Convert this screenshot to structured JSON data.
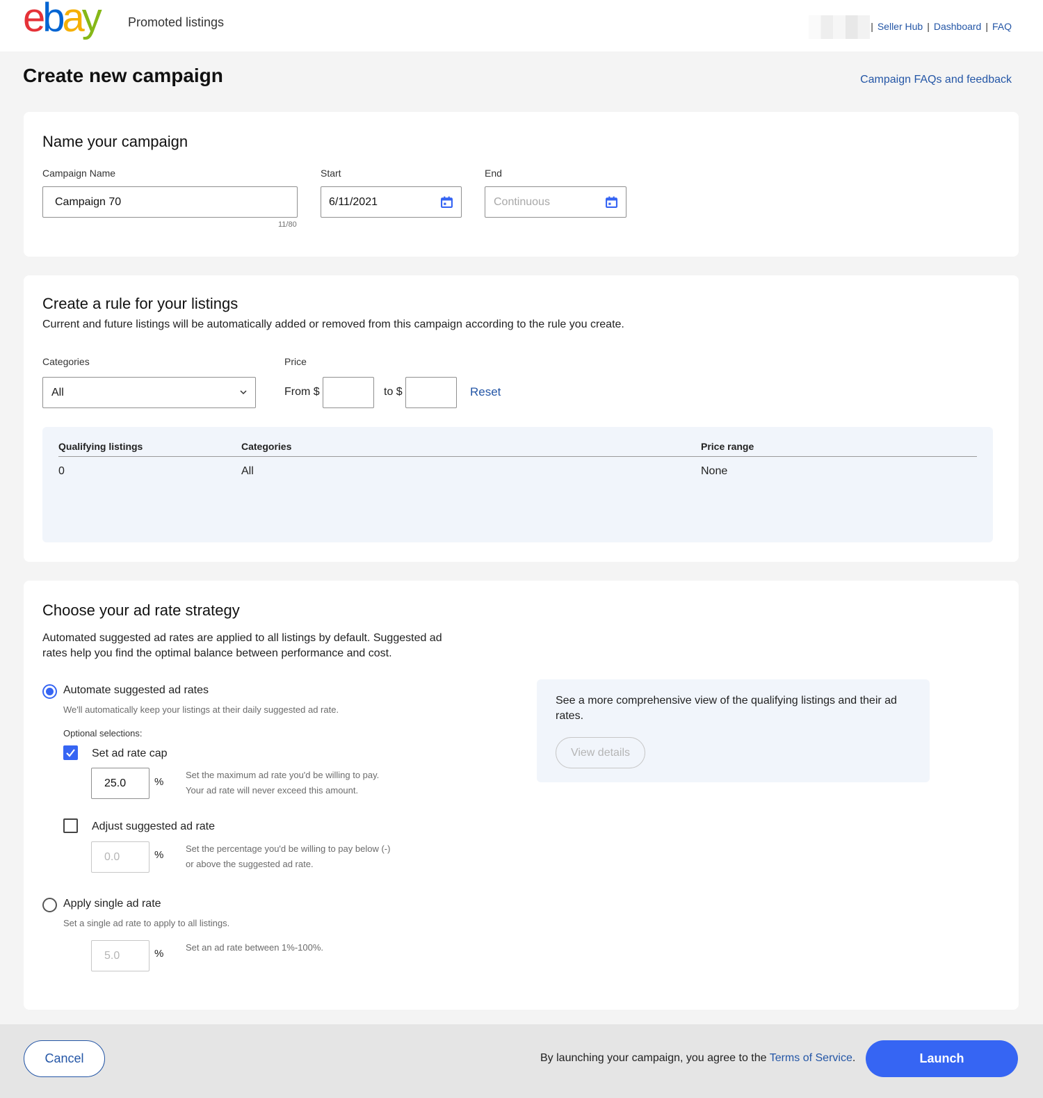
{
  "header": {
    "logo_letters": [
      "e",
      "b",
      "a",
      "y"
    ],
    "product_name": "Promoted listings",
    "links": [
      "Seller Hub",
      "Dashboard",
      "FAQ"
    ],
    "separator": "|"
  },
  "page": {
    "title": "Create new campaign",
    "faq_link": "Campaign FAQs and feedback"
  },
  "name_section": {
    "heading": "Name your campaign",
    "campaign_name_label": "Campaign Name",
    "campaign_name_value": "Campaign 70",
    "char_counter": "11/80",
    "start_label": "Start",
    "start_value": "6/11/2021",
    "end_label": "End",
    "end_placeholder": "Continuous"
  },
  "rule_section": {
    "heading": "Create a rule for your listings",
    "description": "Current and future listings will be automatically added or removed from this campaign according to the rule you create.",
    "categories_label": "Categories",
    "categories_value": "All",
    "price_label": "Price",
    "from_label": "From $",
    "to_label": "to $",
    "reset_label": "Reset",
    "summary": {
      "headers": [
        "Qualifying listings",
        "Categories",
        "Price range"
      ],
      "values": [
        "0",
        "All",
        "None"
      ]
    }
  },
  "strategy_section": {
    "heading": "Choose your ad rate strategy",
    "description": "Automated suggested ad rates are applied to all listings by default. Suggested ad rates help you find the optimal balance between performance and cost.",
    "automate_label": "Automate suggested ad rates",
    "automate_hint": "We'll automatically keep your listings at their daily suggested ad rate.",
    "optional_label": "Optional selections:",
    "cap_label": "Set ad rate cap",
    "cap_value": "25.0",
    "cap_hint_1": "Set the maximum ad rate you'd be willing to pay.",
    "cap_hint_2": "Your ad rate will never exceed this amount.",
    "adjust_label": "Adjust suggested ad rate",
    "adjust_value": "0.0",
    "adjust_hint_1": "Set the percentage you'd be willing to pay below (-)",
    "adjust_hint_2": "or above the suggested ad rate.",
    "single_label": "Apply single ad rate",
    "single_hint": "Set a single ad rate to apply to all listings.",
    "single_value": "5.0",
    "single_rate_hint": "Set an ad rate between 1%-100%.",
    "percent": "%",
    "info_text": "See a more comprehensive view of the qualifying listings and their ad rates.",
    "view_details": "View details"
  },
  "footer": {
    "cancel_label": "Cancel",
    "terms_prefix": "By launching your campaign, you agree to the ",
    "terms_link": "Terms of Service",
    "terms_suffix": ".",
    "launch_label": "Launch"
  },
  "colors": {
    "accent": "#3665f3",
    "link": "#2456a6",
    "summary_bg": "#f1f5fb"
  }
}
